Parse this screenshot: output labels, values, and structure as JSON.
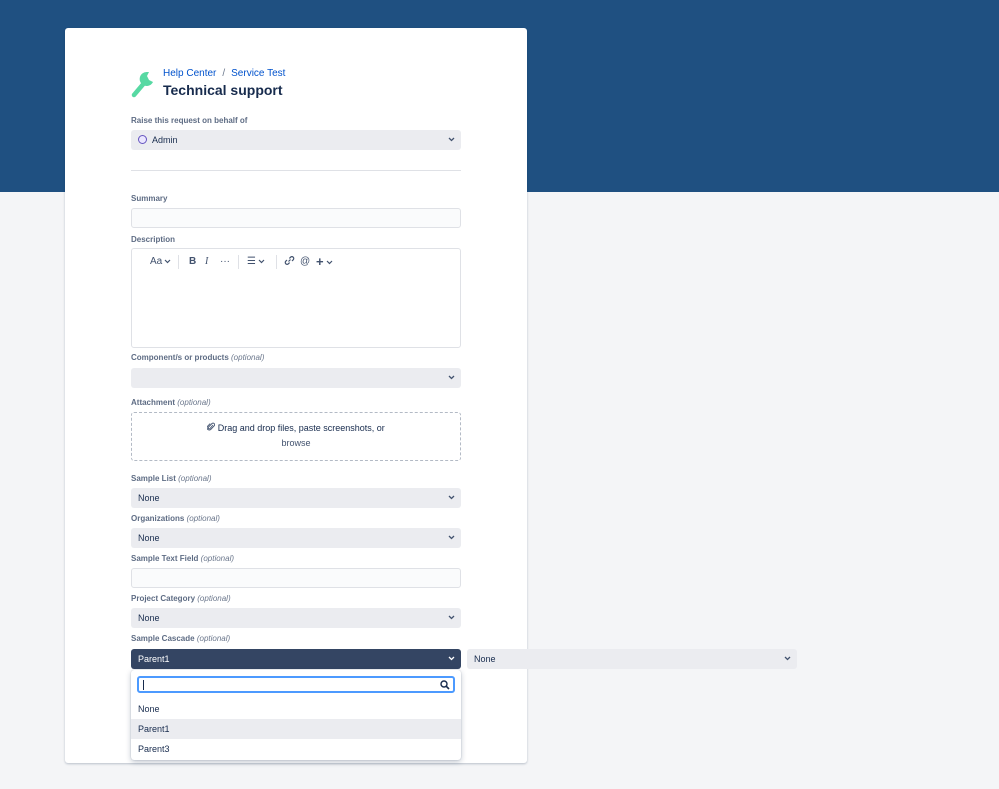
{
  "breadcrumbs": {
    "help_center": "Help Center",
    "separator": "/",
    "service": "Service Test"
  },
  "page_title": "Technical support",
  "raise_on_behalf": {
    "label": "Raise this request on behalf of",
    "value": "Admin"
  },
  "summary": {
    "label": "Summary",
    "value": ""
  },
  "description": {
    "label": "Description",
    "toolbar": {
      "text_style": "Aa",
      "bold": "B",
      "italic": "I",
      "more": "···",
      "list": "☰",
      "mention": "@",
      "insert": "+"
    }
  },
  "components": {
    "label": "Component/s or products",
    "optional": "(optional)",
    "value": ""
  },
  "attachment": {
    "label": "Attachment",
    "optional": "(optional)",
    "drop_text": "Drag and drop files, paste screenshots, or",
    "browse": "browse"
  },
  "sample_list": {
    "label": "Sample List",
    "optional": "(optional)",
    "value": "None"
  },
  "organizations": {
    "label": "Organizations",
    "optional": "(optional)",
    "value": "None"
  },
  "sample_text": {
    "label": "Sample Text Field",
    "optional": "(optional)",
    "value": ""
  },
  "project_category": {
    "label": "Project Category",
    "optional": "(optional)",
    "value": "None"
  },
  "sample_cascade": {
    "label": "Sample Cascade",
    "optional": "(optional)",
    "parent_value": "Parent1",
    "child_value": "None",
    "search_value": "",
    "options": [
      "None",
      "Parent1",
      "Parent3"
    ],
    "highlighted_index": 1
  },
  "colors": {
    "banner": "#1f5081",
    "link": "#0052cc",
    "wrench": "#57d9a3",
    "focus": "#4c9aff"
  },
  "icons": {
    "logo": "wrench-icon",
    "attach": "paperclip-icon",
    "search": "search-icon",
    "chevron": "chevron-down-icon"
  }
}
